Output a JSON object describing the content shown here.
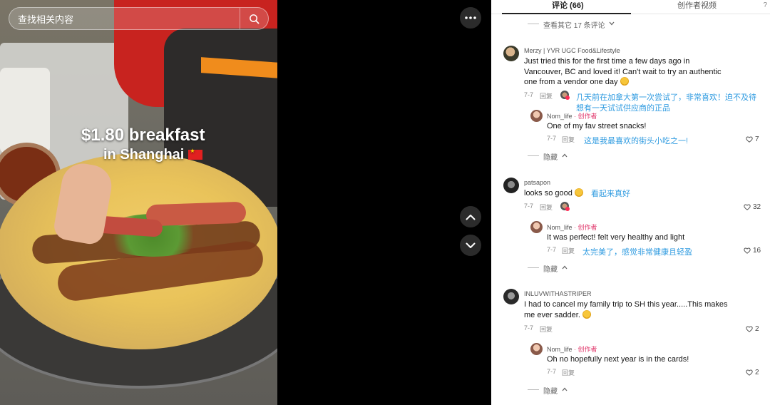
{
  "search": {
    "placeholder": "查找相关内容"
  },
  "video": {
    "caption_line1": "$1.80 breakfast",
    "caption_line2": "in Shanghai"
  },
  "tabs": {
    "comments": "评论 (66)",
    "creator_videos": "创作者视频",
    "help": "?"
  },
  "view_more": "查看其它 17 条评论",
  "comments": [
    {
      "user": "Merzy | YVR UGC Food&Lifestyle",
      "text": [
        "Just tried this for the first time a few days ago in",
        "Vancouver, BC and loved it! Can't wait to try an authentic",
        "one from a vendor one day"
      ],
      "date": "7-7",
      "reply": "回复",
      "translation": [
        "几天前在加拿大第一次尝试了，非常喜欢！迫不及待",
        "想有一天试试供应商的正品"
      ],
      "replies": [
        {
          "user": "Nom_life",
          "creator_tag": "· 创作者",
          "text": "One of my fav street snacks!",
          "date": "7-7",
          "reply": "回复",
          "translation": "这是我最喜欢的街头小吃之一!",
          "likes": "7"
        }
      ],
      "collapse": "隐藏"
    },
    {
      "user": "patsapon",
      "text": [
        "looks so good"
      ],
      "translation_inline": "看起来真好",
      "date": "7-7",
      "reply": "回复",
      "likes": "32",
      "replies": [
        {
          "user": "Nom_life",
          "creator_tag": "· 创作者",
          "text": "It was perfect! felt very healthy and light",
          "date": "7-7",
          "reply": "回复",
          "translation": "太完美了，感觉非常健康且轻盈",
          "likes": "16"
        }
      ],
      "collapse": "隐藏"
    },
    {
      "user": "INLUVWITHASTRIPER",
      "text": [
        "I had to cancel my family trip to SH this year.....This makes",
        "me ever sadder."
      ],
      "date": "7-7",
      "reply": "回复",
      "likes": "2",
      "replies": [
        {
          "user": "Nom_life",
          "creator_tag": "· 创作者",
          "text": "Oh no hopefully next year is in the cards!",
          "date": "7-7",
          "reply": "回复",
          "likes": "2"
        }
      ],
      "collapse": "隐藏"
    }
  ]
}
